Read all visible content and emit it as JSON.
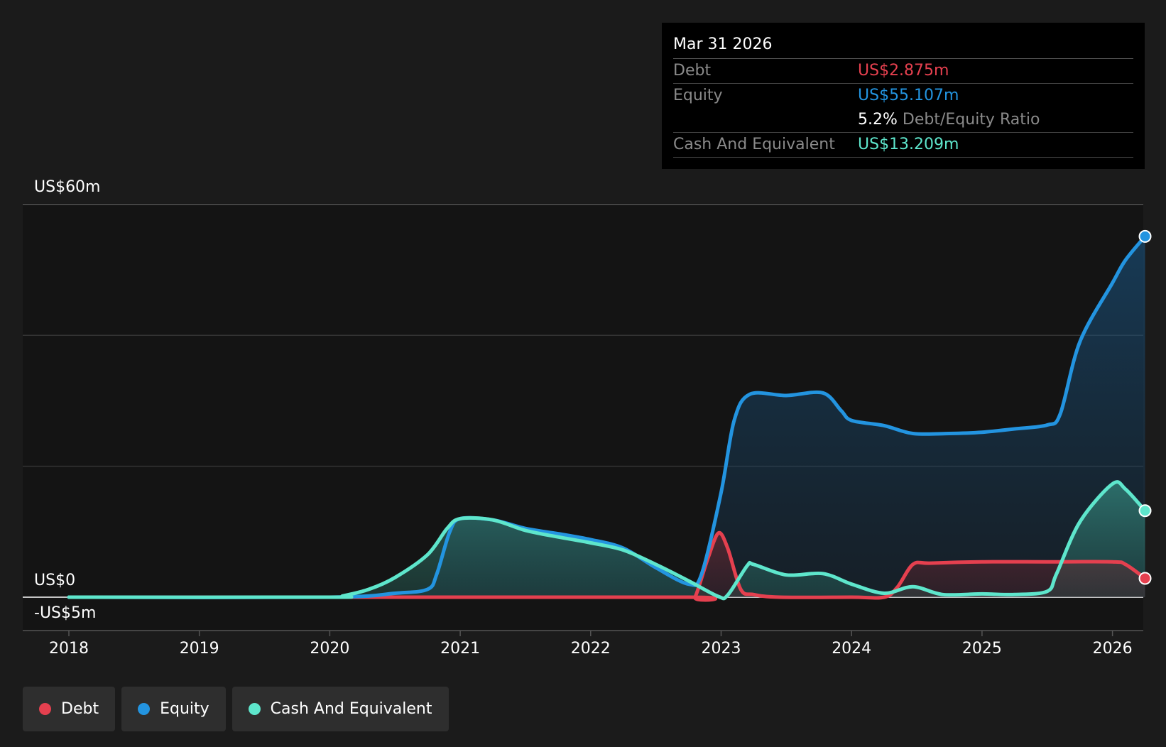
{
  "tooltip": {
    "date": "Mar 31 2026",
    "debt_label": "Debt",
    "debt_value": "US$2.875m",
    "equity_label": "Equity",
    "equity_value": "US$55.107m",
    "ratio_value": "5.2%",
    "ratio_label": "Debt/Equity Ratio",
    "cash_label": "Cash And Equivalent",
    "cash_value": "US$13.209m"
  },
  "legend": {
    "debt": "Debt",
    "equity": "Equity",
    "cash": "Cash And Equivalent"
  },
  "colors": {
    "debt": "#e5404f",
    "equity": "#2394e0",
    "cash": "#5ee6cc"
  },
  "chart_data": {
    "type": "area",
    "x_tick_labels": [
      "2018",
      "2019",
      "2020",
      "2021",
      "2022",
      "2023",
      "2024",
      "2025",
      "2026"
    ],
    "y_tick_labels": {
      "top": "US$60m",
      "zero": "US$0",
      "bottom": "-US$5m"
    },
    "ylim": [
      -5,
      60
    ],
    "xlim": [
      2017.65,
      2026.25
    ],
    "grid": true,
    "legend_position": "bottom-left",
    "series": [
      {
        "name": "Debt",
        "key": "debt",
        "points": [
          [
            2018.0,
            0
          ],
          [
            2020.0,
            0
          ],
          [
            2022.75,
            0
          ],
          [
            2022.8,
            0
          ],
          [
            2022.9,
            6
          ],
          [
            2022.98,
            9.8
          ],
          [
            2023.05,
            7.5
          ],
          [
            2023.15,
            1.2
          ],
          [
            2023.25,
            0.4
          ],
          [
            2023.45,
            0
          ],
          [
            2024.0,
            0
          ],
          [
            2024.25,
            0
          ],
          [
            2024.35,
            1.5
          ],
          [
            2024.47,
            5
          ],
          [
            2024.6,
            5.2
          ],
          [
            2025.0,
            5.4
          ],
          [
            2025.5,
            5.4
          ],
          [
            2026.0,
            5.4
          ],
          [
            2026.1,
            5.0
          ],
          [
            2026.25,
            2.875
          ]
        ]
      },
      {
        "name": "Equity",
        "key": "equity",
        "points": [
          [
            2018.0,
            0
          ],
          [
            2020.0,
            0
          ],
          [
            2020.5,
            0.6
          ],
          [
            2020.75,
            1.2
          ],
          [
            2020.82,
            3.5
          ],
          [
            2020.92,
            10
          ],
          [
            2021.0,
            12
          ],
          [
            2021.25,
            11.8
          ],
          [
            2021.5,
            10.5
          ],
          [
            2021.75,
            9.7
          ],
          [
            2022.0,
            8.8
          ],
          [
            2022.25,
            7.5
          ],
          [
            2022.5,
            4.5
          ],
          [
            2022.75,
            2.0
          ],
          [
            2022.85,
            3.5
          ],
          [
            2023.0,
            16
          ],
          [
            2023.1,
            27
          ],
          [
            2023.22,
            31
          ],
          [
            2023.5,
            30.8
          ],
          [
            2023.78,
            31.2
          ],
          [
            2023.92,
            28.5
          ],
          [
            2024.0,
            27
          ],
          [
            2024.25,
            26.2
          ],
          [
            2024.47,
            25
          ],
          [
            2024.75,
            25
          ],
          [
            2025.0,
            25.2
          ],
          [
            2025.25,
            25.7
          ],
          [
            2025.5,
            26.3
          ],
          [
            2025.6,
            28
          ],
          [
            2025.75,
            39
          ],
          [
            2026.0,
            48
          ],
          [
            2026.1,
            51.5
          ],
          [
            2026.25,
            55.107
          ]
        ]
      },
      {
        "name": "Cash And Equivalent",
        "key": "cash",
        "points": [
          [
            2018.0,
            0
          ],
          [
            2020.0,
            0
          ],
          [
            2020.1,
            0.2
          ],
          [
            2020.3,
            1.2
          ],
          [
            2020.5,
            3.0
          ],
          [
            2020.75,
            6.5
          ],
          [
            2020.9,
            10.5
          ],
          [
            2021.0,
            12
          ],
          [
            2021.25,
            11.8
          ],
          [
            2021.5,
            10.2
          ],
          [
            2021.75,
            9.2
          ],
          [
            2022.0,
            8.3
          ],
          [
            2022.25,
            7.2
          ],
          [
            2022.5,
            5.0
          ],
          [
            2022.75,
            2.5
          ],
          [
            2022.98,
            0.1
          ],
          [
            2023.05,
            0.3
          ],
          [
            2023.2,
            4.8
          ],
          [
            2023.25,
            5
          ],
          [
            2023.5,
            3.4
          ],
          [
            2023.78,
            3.6
          ],
          [
            2024.0,
            2.0
          ],
          [
            2024.25,
            0.6
          ],
          [
            2024.47,
            1.6
          ],
          [
            2024.7,
            0.4
          ],
          [
            2025.0,
            0.5
          ],
          [
            2025.25,
            0.4
          ],
          [
            2025.5,
            0.9
          ],
          [
            2025.57,
            3.5
          ],
          [
            2025.75,
            11.5
          ],
          [
            2026.0,
            17.3
          ],
          [
            2026.1,
            16.5
          ],
          [
            2026.25,
            13.209
          ]
        ]
      }
    ]
  }
}
